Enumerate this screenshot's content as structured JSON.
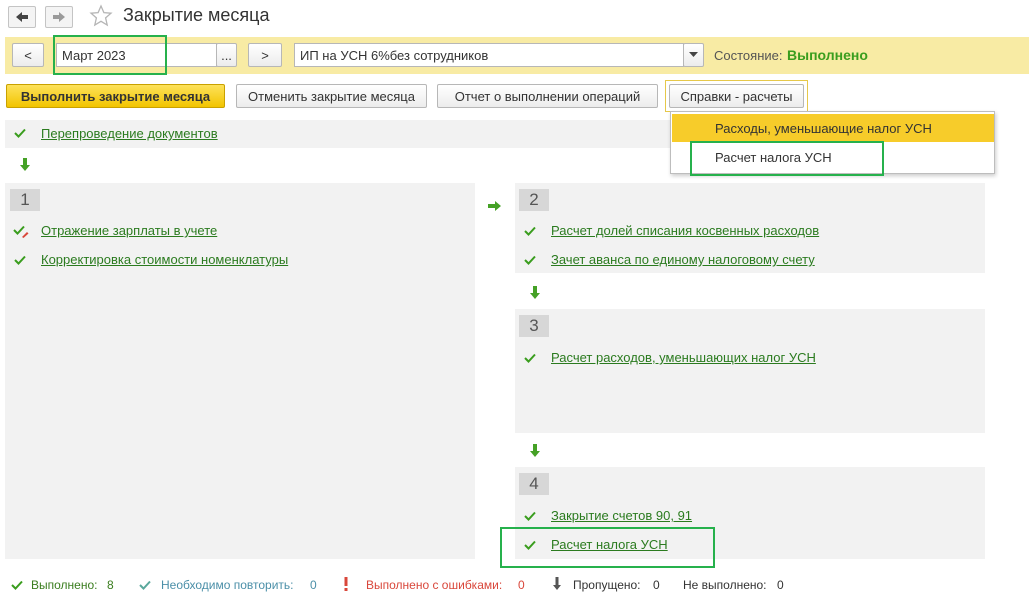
{
  "header": {
    "back_icon": "arrow-left-icon",
    "forward_icon": "arrow-right-icon",
    "favorite_icon": "star-icon",
    "title": "Закрытие месяца"
  },
  "params": {
    "prev_label": "<",
    "period_value": "Март 2023",
    "period_select_label": "...",
    "next_label": ">",
    "organization_value": "ИП на УСН 6%без сотрудников",
    "status_label": "Состояние:",
    "status_value": "Выполнено"
  },
  "toolbar": {
    "run_label": "Выполнить закрытие месяца",
    "cancel_label": "Отменить закрытие месяца",
    "report_label": "Отчет о выполнении операций",
    "reports_menu_label": "Справки - расчеты"
  },
  "menu": {
    "items": [
      {
        "label": "Расходы, уменьшающие налог УСН"
      },
      {
        "label": "Расчет налога УСН"
      }
    ]
  },
  "steps": {
    "repost": "Перепроведение документов",
    "group1": {
      "number": "1",
      "items": [
        "Отражение зарплаты в учете",
        "Корректировка стоимости номенклатуры"
      ]
    },
    "group2": {
      "number": "2",
      "items": [
        "Расчет долей списания косвенных расходов",
        "Зачет аванса по единому налоговому счету"
      ]
    },
    "group3": {
      "number": "3",
      "items": [
        "Расчет расходов, уменьшающих налог УСН"
      ]
    },
    "group4": {
      "number": "4",
      "items": [
        "Закрытие счетов 90, 91",
        "Расчет налога УСН"
      ]
    }
  },
  "legend": {
    "done_label": "Выполнено:",
    "done_count": "8",
    "repeat_label": "Необходимо повторить:",
    "repeat_count": "0",
    "errors_label": "Выполнено с ошибками:",
    "errors_count": "0",
    "skipped_label": "Пропущено:",
    "skipped_count": "0",
    "not_done_label": "Не выполнено:",
    "not_done_count": "0"
  },
  "colors": {
    "accent_yellow": "#f8eba4",
    "done_green": "#3a9d1e",
    "link_green": "#2b7b1f",
    "highlight_green": "#26b14c"
  }
}
